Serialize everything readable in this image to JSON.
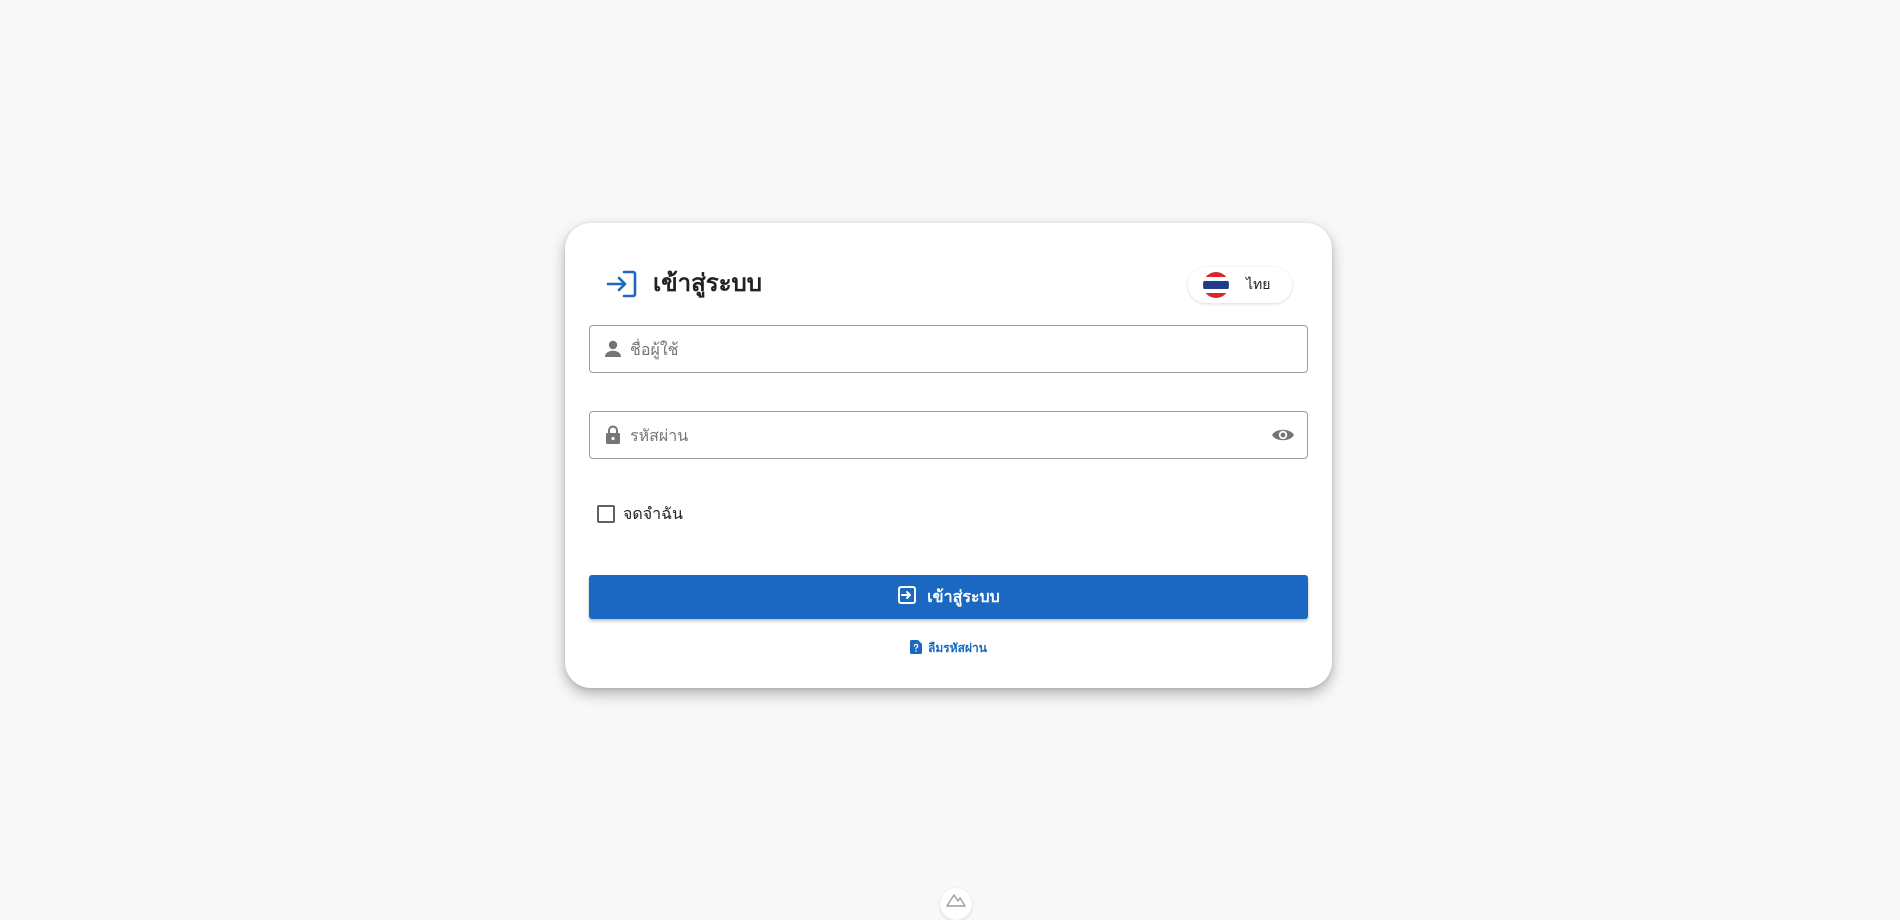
{
  "login": {
    "title": "เข้าสู่ระบบ",
    "language_label": "ไทย",
    "username": {
      "placeholder": "ชื่อผู้ใช้",
      "value": ""
    },
    "password": {
      "placeholder": "รหัสผ่าน",
      "value": ""
    },
    "remember_label": "จดจำฉัน",
    "remember_checked": false,
    "submit_label": "เข้าสู่ระบบ",
    "forgot_label": "ลืมรหัสผ่าน"
  },
  "colors": {
    "primary": "#1a68c2",
    "background": "#f8f8f8",
    "card": "#ffffff"
  },
  "icons": {
    "title": "login-icon",
    "language": "thailand-flag-icon",
    "username": "person-icon",
    "password": "lock-icon",
    "toggle_password": "eye-icon",
    "submit": "login-icon",
    "forgot": "file-question-icon",
    "footer": "logo-icon"
  }
}
